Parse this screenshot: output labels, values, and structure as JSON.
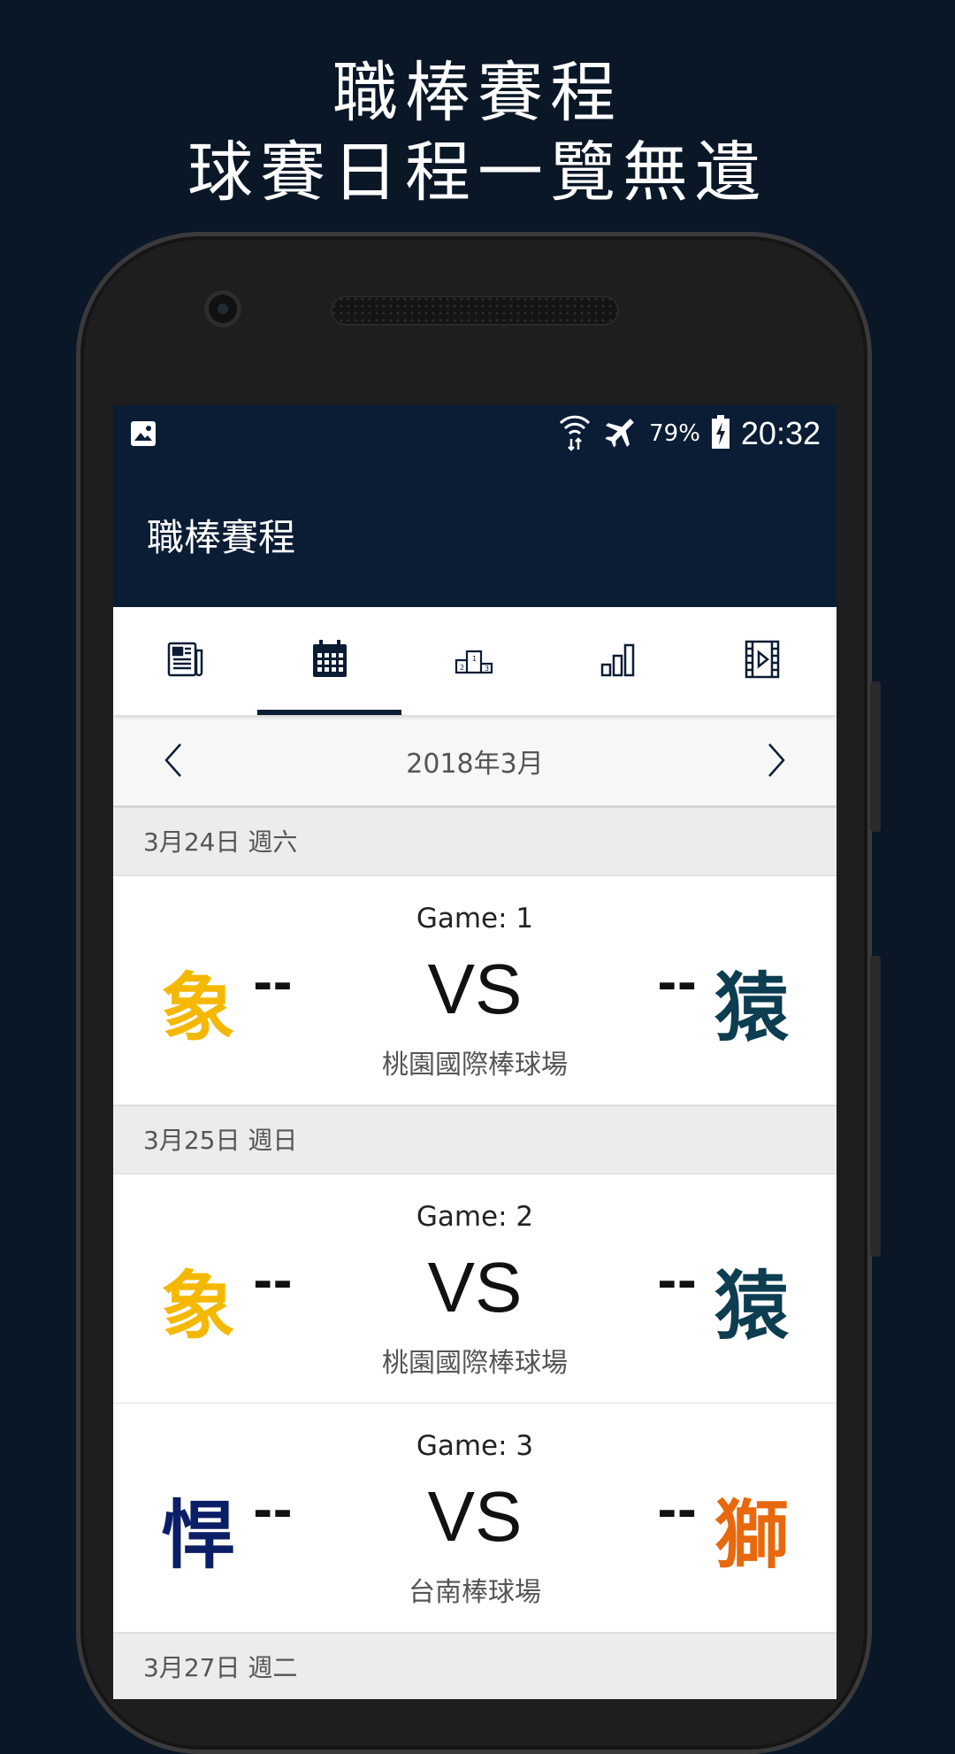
{
  "promo": {
    "line1": "職棒賽程",
    "line2": "球賽日程一覽無遺"
  },
  "status": {
    "battery": "79%",
    "time": "20:32"
  },
  "appbar": {
    "title": "職棒賽程"
  },
  "tabs": [
    {
      "icon": "newspaper-icon"
    },
    {
      "icon": "calendar-icon"
    },
    {
      "icon": "podium-icon"
    },
    {
      "icon": "bar-chart-icon"
    },
    {
      "icon": "video-icon"
    }
  ],
  "month": {
    "label": "2018年3月"
  },
  "colors": {
    "elephants": "#f5b800",
    "monkeys": "#0c3d50",
    "guardians": "#0c1e66",
    "lions": "#e8680d",
    "primary": "#0b1c35"
  },
  "schedule": [
    {
      "date": "3月24日 週六",
      "games": [
        {
          "game": "Game: 1",
          "home": "象",
          "home_score": "--",
          "vs": "VS",
          "away": "猿",
          "away_score": "--",
          "venue": "桃園國際棒球場"
        }
      ]
    },
    {
      "date": "3月25日 週日",
      "games": [
        {
          "game": "Game: 2",
          "home": "象",
          "home_score": "--",
          "vs": "VS",
          "away": "猿",
          "away_score": "--",
          "venue": "桃園國際棒球場"
        },
        {
          "game": "Game: 3",
          "home": "悍",
          "home_score": "--",
          "vs": "VS",
          "away": "獅",
          "away_score": "--",
          "venue": "台南棒球場"
        }
      ]
    },
    {
      "date": "3月27日 週二",
      "games": []
    }
  ]
}
